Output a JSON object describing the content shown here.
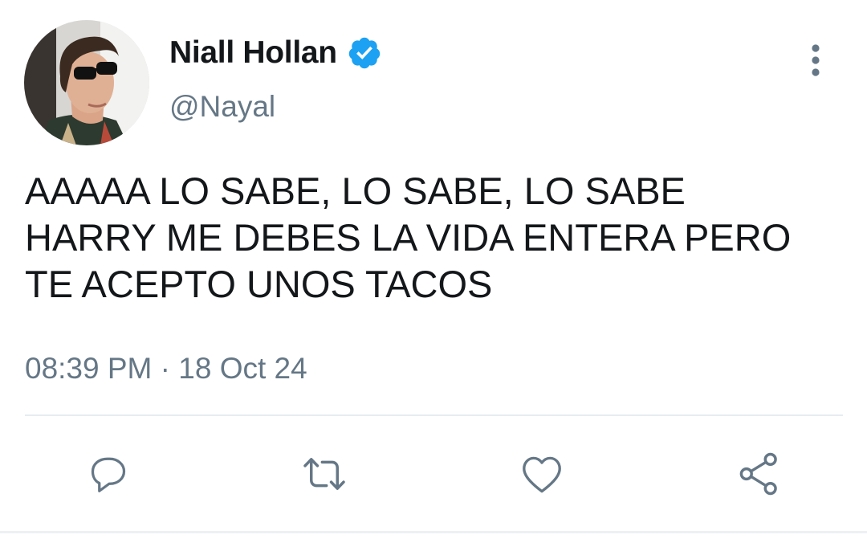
{
  "tweet": {
    "author": {
      "display_name": "Niall Hollan",
      "handle": "@Nayal",
      "verified": true
    },
    "text_lines": [
      "AAAAA LO SABE, LO SABE, LO SABE",
      "HARRY ME DEBES LA VIDA ENTERA PERO",
      "TE ACEPTO UNOS TACOS"
    ],
    "time": "08:39 PM",
    "separator": "·",
    "date": "18 Oct 24"
  },
  "icons": {
    "verified": "verified-badge-icon",
    "more": "more-vertical-icon",
    "reply": "reply-icon",
    "retweet": "retweet-icon",
    "like": "heart-icon",
    "share": "share-icon"
  },
  "colors": {
    "text": "#14171a",
    "secondary": "#657786",
    "verified": "#1da1f2",
    "icon": "#657786",
    "divider": "#e6ecf0"
  }
}
